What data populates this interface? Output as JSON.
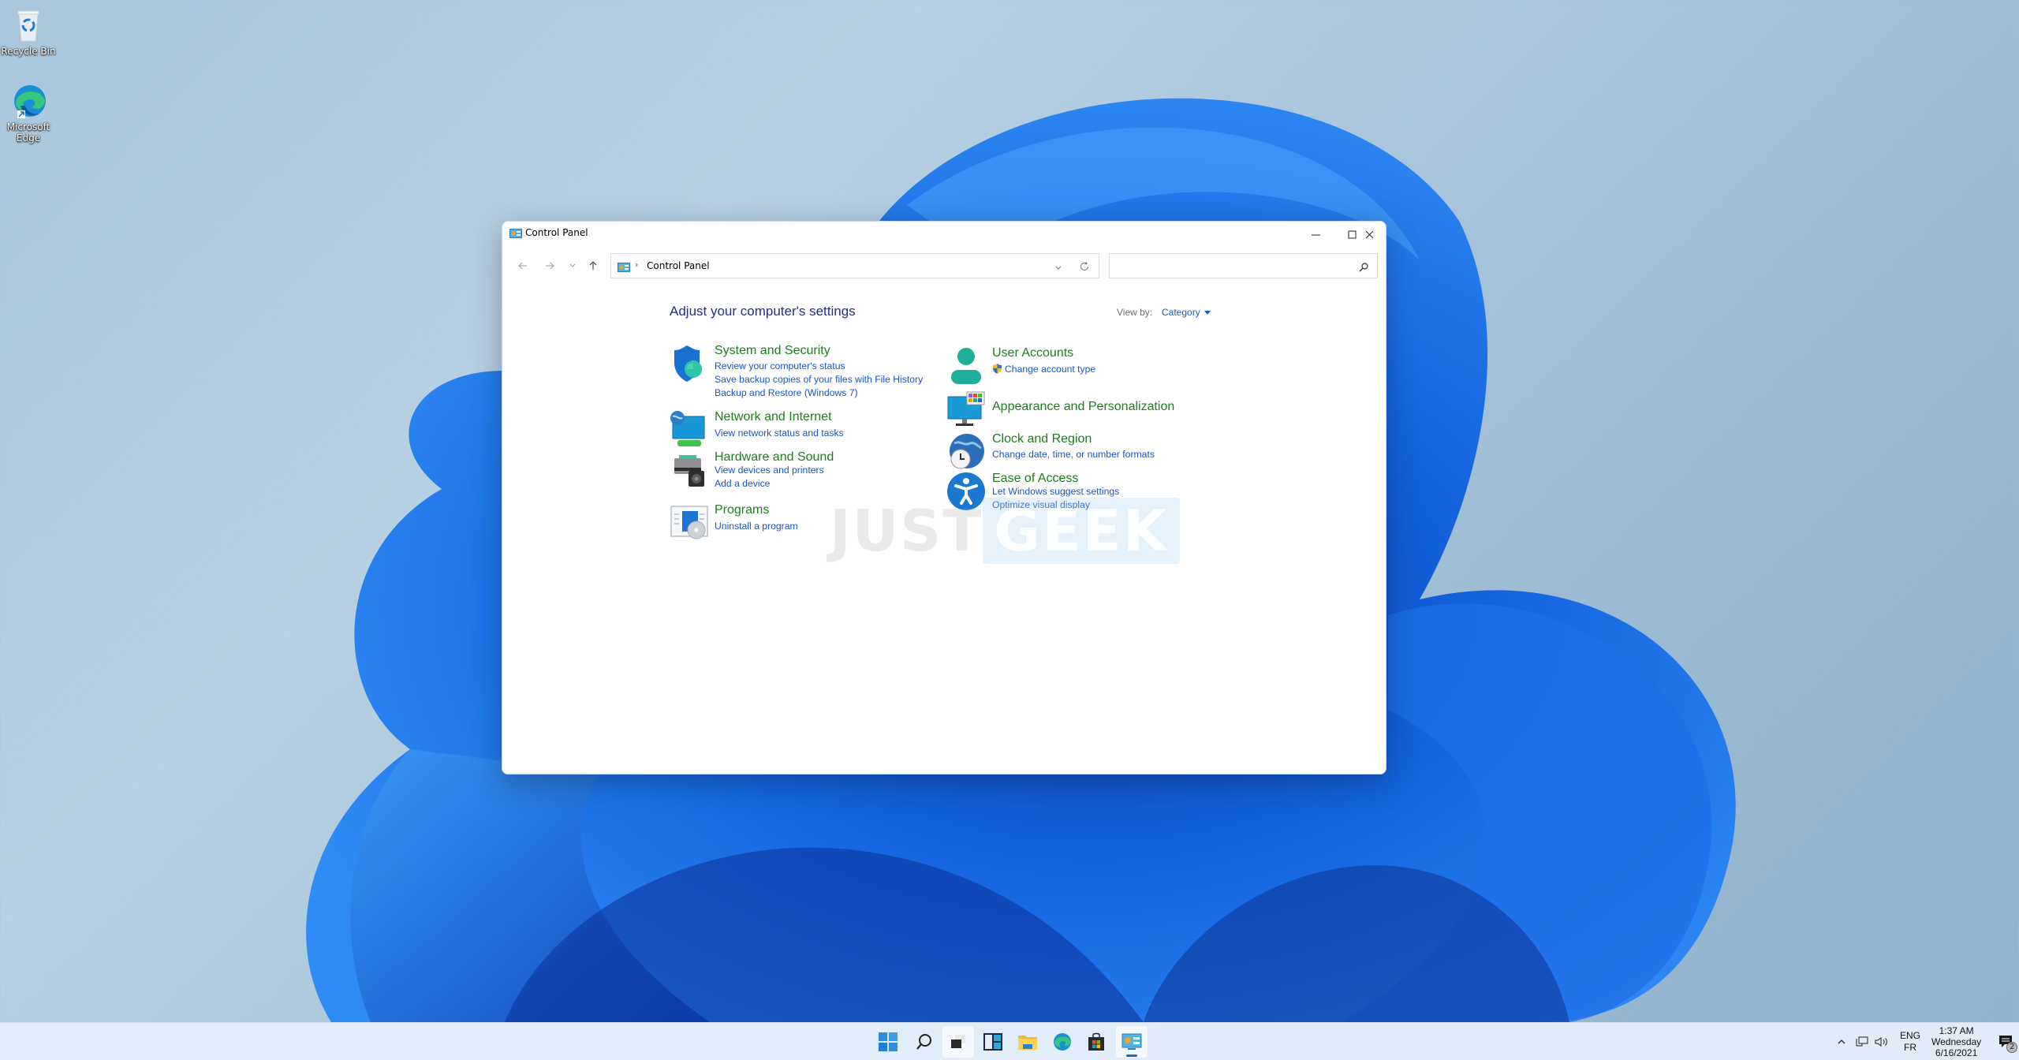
{
  "desktop": {
    "icons": [
      {
        "label": "Recycle Bin",
        "icon": "recycle-bin-icon"
      },
      {
        "label": "Microsoft Edge",
        "icon": "edge-icon"
      }
    ]
  },
  "window": {
    "title": "Control Panel",
    "icon": "control-panel-icon",
    "controls": {
      "minimize": "minimize",
      "maximize": "maximize",
      "close": "close"
    },
    "nav": {
      "back": "back-arrow",
      "forward": "forward-arrow",
      "recent": "recent-locations",
      "up": "up-arrow"
    },
    "address": {
      "separator": "›",
      "breadcrumb": "Control Panel"
    },
    "search": {
      "value": "",
      "placeholder": ""
    },
    "heading": "Adjust your computer's settings",
    "view_by": {
      "label": "View by:",
      "value": "Category"
    },
    "categories_left": [
      {
        "title": "System and Security",
        "icon": "shield-icon",
        "links": [
          "Review your computer's status",
          "Save backup copies of your files with File History",
          "Backup and Restore (Windows 7)"
        ]
      },
      {
        "title": "Network and Internet",
        "icon": "network-icon",
        "links": [
          "View network status and tasks"
        ]
      },
      {
        "title": "Hardware and Sound",
        "icon": "printer-speaker-icon",
        "links": [
          "View devices and printers",
          "Add a device"
        ]
      },
      {
        "title": "Programs",
        "icon": "programs-disc-icon",
        "links": [
          "Uninstall a program"
        ]
      }
    ],
    "categories_right": [
      {
        "title": "User Accounts",
        "icon": "user-icon",
        "links": [
          "Change account type"
        ]
      },
      {
        "title": "Appearance and Personalization",
        "icon": "monitor-colors-icon",
        "links": []
      },
      {
        "title": "Clock and Region",
        "icon": "clock-globe-icon",
        "links": [
          "Change date, time, or number formats"
        ]
      },
      {
        "title": "Ease of Access",
        "icon": "accessibility-icon",
        "links": [
          "Let Windows suggest settings",
          "Optimize visual display"
        ]
      }
    ],
    "watermark": {
      "part1": "JUST",
      "part2": "GEEK"
    }
  },
  "taskbar": {
    "apps": [
      {
        "name": "Start",
        "icon": "windows-start-icon"
      },
      {
        "name": "Search",
        "icon": "search-icon"
      },
      {
        "name": "Task View",
        "icon": "task-view-icon"
      },
      {
        "name": "Widgets",
        "icon": "widgets-icon"
      },
      {
        "name": "File Explorer",
        "icon": "folder-icon"
      },
      {
        "name": "Microsoft Edge",
        "icon": "edge-icon"
      },
      {
        "name": "Microsoft Store",
        "icon": "store-icon"
      },
      {
        "name": "Control Panel",
        "icon": "control-panel-icon",
        "active": true
      }
    ],
    "tray": {
      "lang_top": "ENG",
      "lang_bottom": "FR",
      "time": "1:37 AM",
      "day": "Wednesday",
      "date": "6/16/2021",
      "notification_count": "2"
    }
  },
  "colors": {
    "category_title": "#1c7d1c",
    "link": "#1b55c4",
    "heading": "#1e3287",
    "accent": "#1a6bc9"
  }
}
